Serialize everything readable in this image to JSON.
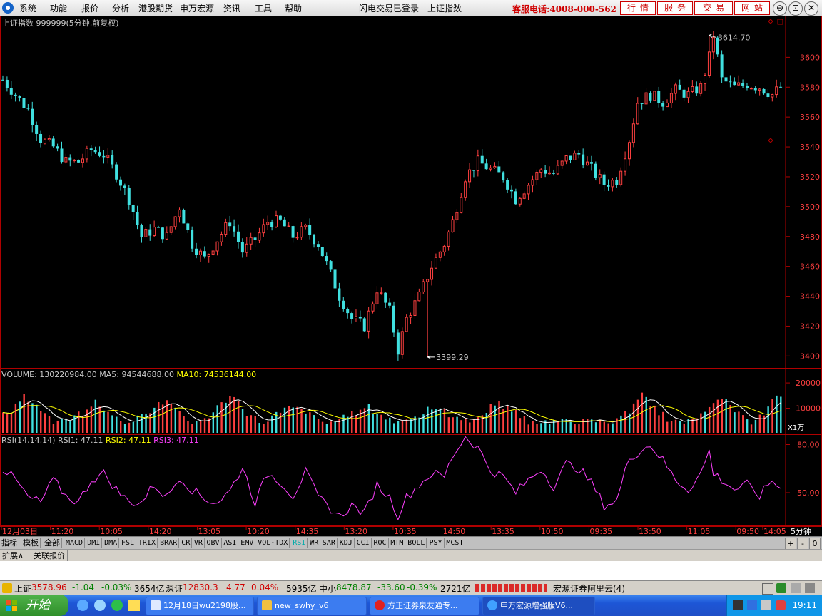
{
  "menu": {
    "items": [
      "系统",
      "功能",
      "报价",
      "分析",
      "港股期货",
      "申万宏源",
      "资讯",
      "工具",
      "帮助"
    ],
    "login_status": "闪电交易已登录",
    "index_name": "上证指数",
    "hotline": "客服电话:4008-000-562",
    "nav_buttons": [
      "行情",
      "服务",
      "交易",
      "网站"
    ],
    "window_controls": [
      "⊖",
      "⊡",
      "✕"
    ]
  },
  "chart_data": {
    "type": "candlestick",
    "title": "上证指数 999999(5分钟,前复权)",
    "colors": {
      "up": "#ff4040",
      "down": "#40e0e0",
      "ma5": "#ffffff",
      "ma10": "#ffff00",
      "rsi": "#ff40ff",
      "axis": "#b00000",
      "label": "#c8c8c8"
    },
    "price_axis": {
      "ticks": [
        3600,
        3580,
        3560,
        3540,
        3520,
        3500,
        3480,
        3460,
        3440,
        3420,
        3400
      ],
      "min": 3393,
      "max": 3625
    },
    "price_path": [
      [
        0,
        3585
      ],
      [
        3,
        3575
      ],
      [
        6,
        3565
      ],
      [
        9,
        3545
      ],
      [
        12,
        3540
      ],
      [
        15,
        3530
      ],
      [
        18,
        3530
      ],
      [
        21,
        3538
      ],
      [
        24,
        3535
      ],
      [
        27,
        3522
      ],
      [
        30,
        3505
      ],
      [
        33,
        3480
      ],
      [
        36,
        3485
      ],
      [
        39,
        3480
      ],
      [
        42,
        3500
      ],
      [
        45,
        3475
      ],
      [
        48,
        3465
      ],
      [
        51,
        3478
      ],
      [
        54,
        3490
      ],
      [
        57,
        3470
      ],
      [
        60,
        3478
      ],
      [
        63,
        3490
      ],
      [
        66,
        3490
      ],
      [
        69,
        3480
      ],
      [
        72,
        3485
      ],
      [
        75,
        3475
      ],
      [
        78,
        3455
      ],
      [
        80,
        3440
      ],
      [
        83,
        3425
      ],
      [
        86,
        3420
      ],
      [
        89,
        3445
      ],
      [
        92,
        3430
      ],
      [
        94,
        3404
      ],
      [
        96,
        3425
      ],
      [
        99,
        3440
      ],
      [
        102,
        3460
      ],
      [
        105,
        3475
      ],
      [
        107,
        3490
      ],
      [
        110,
        3520
      ],
      [
        113,
        3530
      ],
      [
        116,
        3525
      ],
      [
        119,
        3520
      ],
      [
        122,
        3505
      ],
      [
        125,
        3515
      ],
      [
        128,
        3525
      ],
      [
        131,
        3522
      ],
      [
        134,
        3532
      ],
      [
        137,
        3535
      ],
      [
        140,
        3525
      ],
      [
        143,
        3515
      ],
      [
        146,
        3518
      ],
      [
        149,
        3545
      ],
      [
        151,
        3570
      ],
      [
        154,
        3575
      ],
      [
        157,
        3570
      ],
      [
        160,
        3578
      ],
      [
        163,
        3575
      ],
      [
        166,
        3580
      ],
      [
        168,
        3600
      ],
      [
        169,
        3614.7
      ],
      [
        171,
        3585
      ],
      [
        174,
        3580
      ],
      [
        177,
        3582
      ],
      [
        180,
        3580
      ],
      [
        183,
        3575
      ],
      [
        185,
        3580
      ]
    ],
    "high_label": {
      "value": 3614.7,
      "text": "3614.70",
      "bar": 168
    },
    "low_label": {
      "value": 3399.29,
      "text": "3399.29",
      "bar": 101
    },
    "volume": {
      "label": "VOLUME:",
      "value": "130220984.00",
      "ma5_label": "MA5:",
      "ma5": "94544688.00",
      "ma10_label": "MA10:",
      "ma10": "74536144.00",
      "ticks": [
        20000,
        10000
      ],
      "unit": "X1万",
      "max": 22000,
      "peaks": [
        [
          5,
          15000
        ],
        [
          22,
          12500
        ],
        [
          38,
          15500
        ],
        [
          54,
          15000
        ],
        [
          69,
          12000
        ],
        [
          86,
          11500
        ],
        [
          102,
          11000
        ],
        [
          118,
          14000
        ],
        [
          152,
          15000
        ],
        [
          170,
          16000
        ],
        [
          185,
          17000
        ]
      ]
    },
    "rsi": {
      "label": "RSI(14,14,14)",
      "rsi1_label": "RSI1:",
      "rsi1": "47.11",
      "rsi2_label": "RSI2:",
      "rsi2": "47.11",
      "rsi3_label": "RSI3:",
      "rsi3": "47.11",
      "ticks": [
        80.0,
        50.0
      ],
      "min": 30,
      "max": 86,
      "path": [
        [
          0,
          65
        ],
        [
          3,
          58
        ],
        [
          6,
          47
        ],
        [
          9,
          44
        ],
        [
          12,
          58
        ],
        [
          15,
          48
        ],
        [
          18,
          44
        ],
        [
          21,
          58
        ],
        [
          24,
          62
        ],
        [
          27,
          52
        ],
        [
          30,
          44
        ],
        [
          33,
          44
        ],
        [
          36,
          55
        ],
        [
          39,
          47
        ],
        [
          42,
          60
        ],
        [
          45,
          52
        ],
        [
          48,
          46
        ],
        [
          51,
          44
        ],
        [
          54,
          51
        ],
        [
          57,
          66
        ],
        [
          60,
          44
        ],
        [
          63,
          62
        ],
        [
          66,
          57
        ],
        [
          69,
          48
        ],
        [
          72,
          63
        ],
        [
          75,
          47
        ],
        [
          78,
          40
        ],
        [
          80,
          35
        ],
        [
          83,
          42
        ],
        [
          86,
          37
        ],
        [
          89,
          55
        ],
        [
          92,
          47
        ],
        [
          94,
          36
        ],
        [
          96,
          47
        ],
        [
          99,
          55
        ],
        [
          102,
          62
        ],
        [
          105,
          60
        ],
        [
          107,
          73
        ],
        [
          110,
          85
        ],
        [
          113,
          78
        ],
        [
          116,
          64
        ],
        [
          119,
          60
        ],
        [
          122,
          50
        ],
        [
          125,
          58
        ],
        [
          128,
          65
        ],
        [
          131,
          54
        ],
        [
          134,
          68
        ],
        [
          137,
          65
        ],
        [
          140,
          56
        ],
        [
          143,
          42
        ],
        [
          146,
          45
        ],
        [
          149,
          72
        ],
        [
          151,
          75
        ],
        [
          154,
          80
        ],
        [
          157,
          70
        ],
        [
          160,
          58
        ],
        [
          163,
          52
        ],
        [
          166,
          62
        ],
        [
          168,
          76
        ],
        [
          169,
          62
        ],
        [
          171,
          58
        ],
        [
          174,
          52
        ],
        [
          177,
          55
        ],
        [
          180,
          48
        ],
        [
          183,
          58
        ],
        [
          185,
          52
        ]
      ]
    },
    "x_labels": [
      "12月03日",
      "11:20",
      "10:05",
      "14:20",
      "13:05",
      "10:20",
      "14:35",
      "13:20",
      "10:35",
      "14:50",
      "13:35",
      "10:50",
      "09:35",
      "13:50",
      "11:05",
      "09:50",
      "14:05"
    ],
    "period": "5分钟",
    "bar_count": 186
  },
  "indicator_tabs": [
    "指标",
    "模板",
    "全部",
    "MACD",
    "DMI",
    "DMA",
    "FSL",
    "TRIX",
    "BRAR",
    "CR",
    "VR",
    "OBV",
    "ASI",
    "EMV",
    "VOL-TDX",
    "RSI",
    "WR",
    "SAR",
    "KDJ",
    "CCI",
    "ROC",
    "MTM",
    "BOLL",
    "PSY",
    "MCST"
  ],
  "indicator_selected": "RSI",
  "indicator_controls": [
    "+",
    "-",
    "0"
  ],
  "sub_tabs": [
    "扩展∧",
    "关联报价"
  ],
  "status": {
    "sh_label": "上证",
    "sh_price": "3578.96",
    "sh_chg": "-1.04",
    "sh_pct": "-0.03%",
    "sh_amt": "3654亿",
    "sz_label": "深证",
    "sz_price": "12830.3",
    "sz_chg": "4.77",
    "sz_pct": "0.04%",
    "sz_amt": "5935亿",
    "zx_label": "中小",
    "zx_price": "8478.87",
    "zx_chg": "-33.60",
    "zx_pct": "-0.39%",
    "zx_amt": "2721亿",
    "broker": "宏源证券阿里云(4)"
  },
  "taskbar": {
    "start": "开始",
    "windows": [
      "12月18日wu2198股...",
      "new_swhy_v6",
      "方正证券泉友通专...",
      "申万宏源增强版V6..."
    ],
    "clock": "19:11"
  }
}
